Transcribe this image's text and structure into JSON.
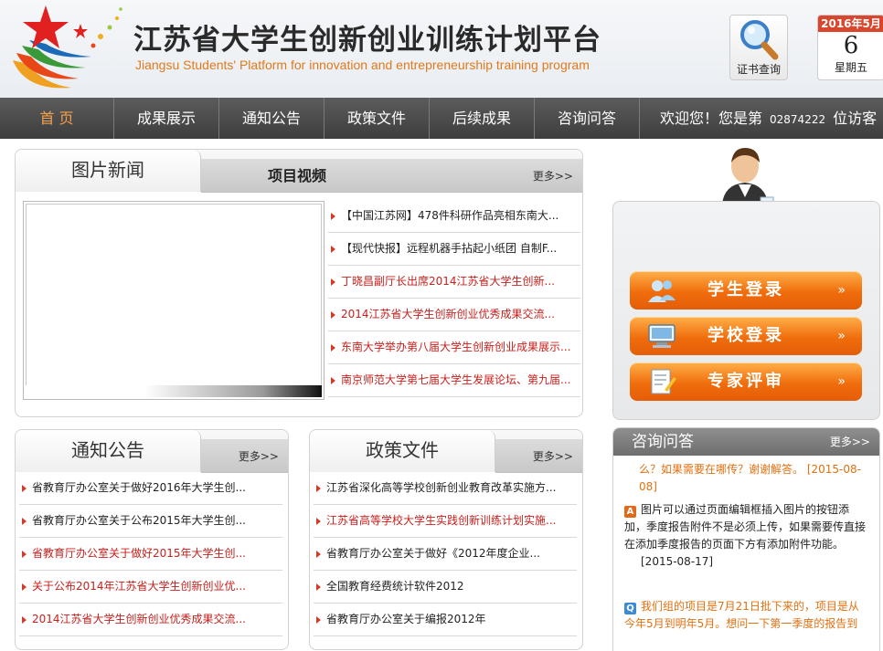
{
  "header": {
    "title_cn": "江苏省大学生创新创业训练计划平台",
    "title_en": "Jiangsu Students' Platform for innovation and entrepreneurship training program",
    "cert_label": "证书查询",
    "date_month": "2016年5月",
    "date_day": "6",
    "date_weekday": "星期五"
  },
  "nav": {
    "items": [
      "首 页",
      "成果展示",
      "通知公告",
      "政策文件",
      "后续成果",
      "咨询问答"
    ],
    "welcome_prefix": "欢迎您！您是第",
    "visitor_count": "02874222",
    "welcome_suffix": "位访客"
  },
  "news": {
    "tab_active": "图片新闻",
    "tab_second": "项目视频",
    "more": "更多>>",
    "items": [
      {
        "text": "【中国江苏网】478件科研作品亮相东南大...",
        "red": false
      },
      {
        "text": "【现代快报】远程机器手拈起小纸团 自制F...",
        "red": false
      },
      {
        "text": "丁晓昌副厅长出席2014江苏省大学生创新...",
        "red": true
      },
      {
        "text": "2014江苏省大学生创新创业优秀成果交流...",
        "red": true
      },
      {
        "text": "东南大学举办第八届大学生创新创业成果展示...",
        "red": true
      },
      {
        "text": "南京师范大学第七届大学生发展论坛、第九届...",
        "red": true
      }
    ]
  },
  "notice": {
    "title": "通知公告",
    "more": "更多>>",
    "items": [
      {
        "text": "省教育厅办公室关于做好2016年大学生创...",
        "red": false
      },
      {
        "text": "省教育厅办公室关于公布2015年大学生创...",
        "red": false
      },
      {
        "text": "省教育厅办公室关于做好2015年大学生创...",
        "red": true
      },
      {
        "text": "关于公布2014年江苏省大学生创新创业优...",
        "red": true
      },
      {
        "text": "2014江苏省大学生创新创业优秀成果交流...",
        "red": true
      }
    ]
  },
  "policy": {
    "title": "政策文件",
    "more": "更多>>",
    "items": [
      {
        "text": "江苏省深化高等学校创新创业教育改革实施方...",
        "red": false
      },
      {
        "text": "江苏省高等学校大学生实践创新训练计划实施...",
        "red": true
      },
      {
        "text": "省教育厅办公室关于做好《2012年度企业...",
        "red": false
      },
      {
        "text": "全国教育经费统计软件2012",
        "red": false
      },
      {
        "text": "省教育厅办公室关于编报2012年",
        "red": false
      }
    ]
  },
  "login": {
    "student": "学生登录",
    "school": "学校登录",
    "expert": "专家评审",
    "arrow": "»"
  },
  "qa": {
    "title": "咨询问答",
    "more": "更多>>",
    "entry1_text": "么？如果需要在哪传？谢谢解答。 [2015-08-08]",
    "entry2_badge": "A",
    "entry2_text": "图片可以通过页面编辑框插入图片的按钮添加，季度报告附件不是必须上传，如果需要传直接在添加季度报告的页面下方有添加附件功能。",
    "entry2_date": "[2015-08-17]",
    "entry3_badge": "Q",
    "entry3_text": "我们组的项目是7月21日批下来的，项目是从今年5月到明年5月。想问一下第一季度的报告到"
  },
  "colors": {
    "accent_orange": "#f06d0c",
    "nav_bg": "#4a4a4a",
    "link_red": "#c8201c",
    "qa_orange": "#e07010"
  }
}
